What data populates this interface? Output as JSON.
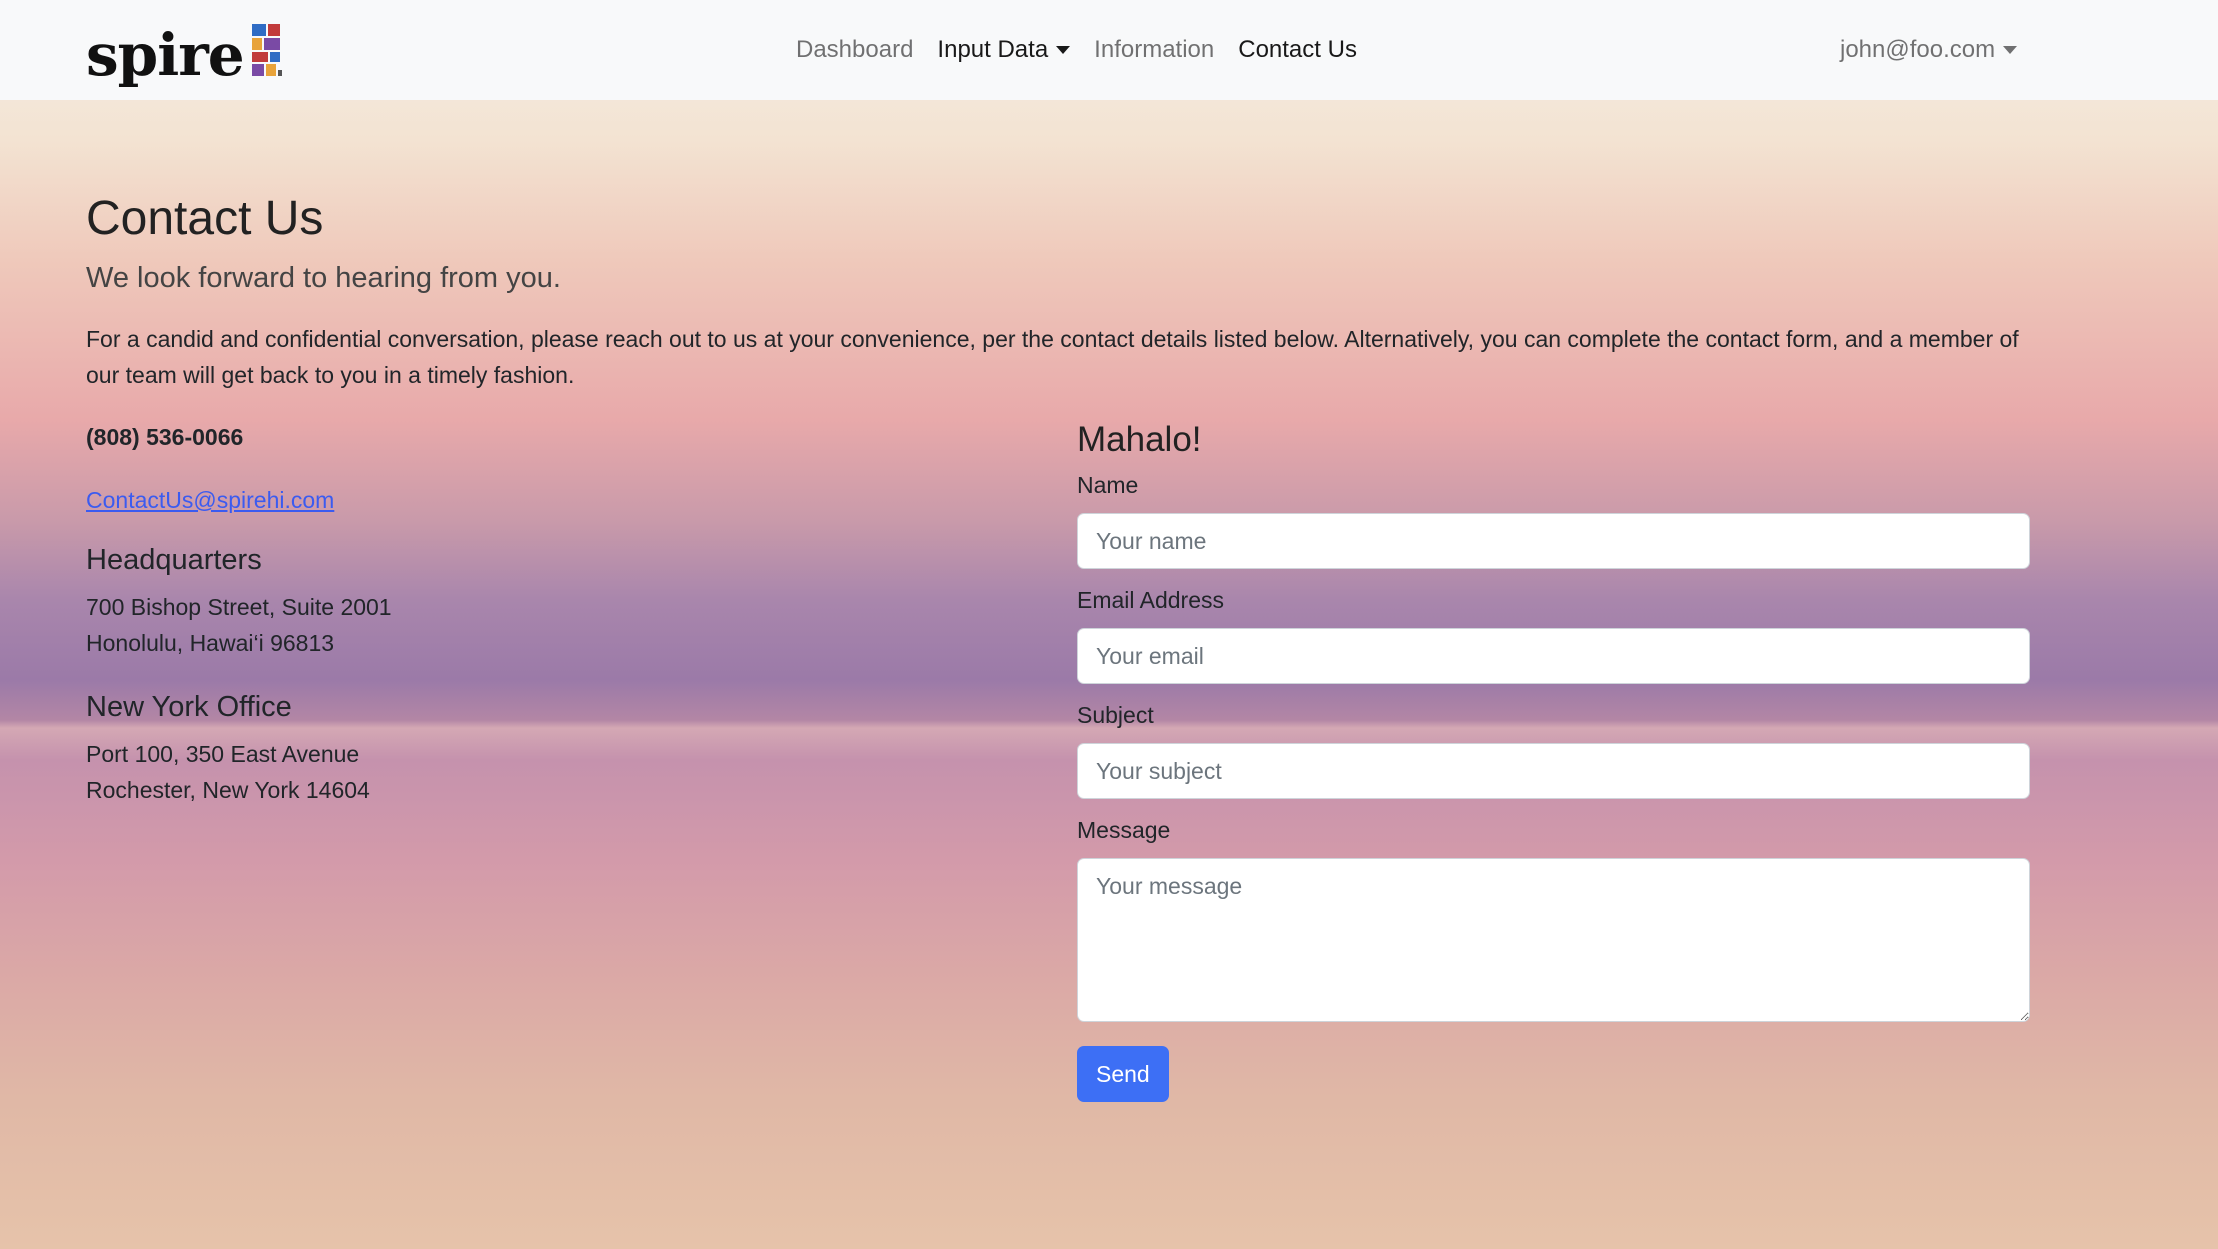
{
  "brand": {
    "name": "spire",
    "logo_icon": "spire-mosaic-logo",
    "colors": [
      "#e8a33a",
      "#7a4aa5",
      "#2f6cc4",
      "#c23b3b"
    ]
  },
  "nav": {
    "dashboard": "Dashboard",
    "input_data": "Input Data",
    "information": "Information",
    "contact_us": "Contact Us",
    "user": "john@foo.com"
  },
  "page": {
    "title": "Contact Us",
    "lead": "We look forward to hearing from you.",
    "intro": "For a candid and confidential conversation, please reach out to us at your convenience, per the contact details listed below. Alternatively, you can complete the contact form, and a member of our team will get back to you in a timely fashion."
  },
  "contact": {
    "phone": "(808) 536-0066",
    "email": "ContactUs@spirehi.com",
    "offices": [
      {
        "title": "Headquarters",
        "line1": "700 Bishop Street, Suite 2001",
        "line2": "Honolulu, Hawai‘i 96813"
      },
      {
        "title": "New York Office",
        "line1": "Port 100, 350 East Avenue",
        "line2": "Rochester, New York 14604"
      }
    ]
  },
  "form": {
    "title": "Mahalo!",
    "name_label": "Name",
    "name_placeholder": "Your name",
    "email_label": "Email Address",
    "email_placeholder": "Your email",
    "subject_label": "Subject",
    "subject_placeholder": "Your subject",
    "message_label": "Message",
    "message_placeholder": "Your message",
    "send_label": "Send"
  },
  "colors": {
    "accent": "#3d6ff5",
    "link": "#3b5bf0",
    "navbar_bg": "#f8f9fa"
  }
}
